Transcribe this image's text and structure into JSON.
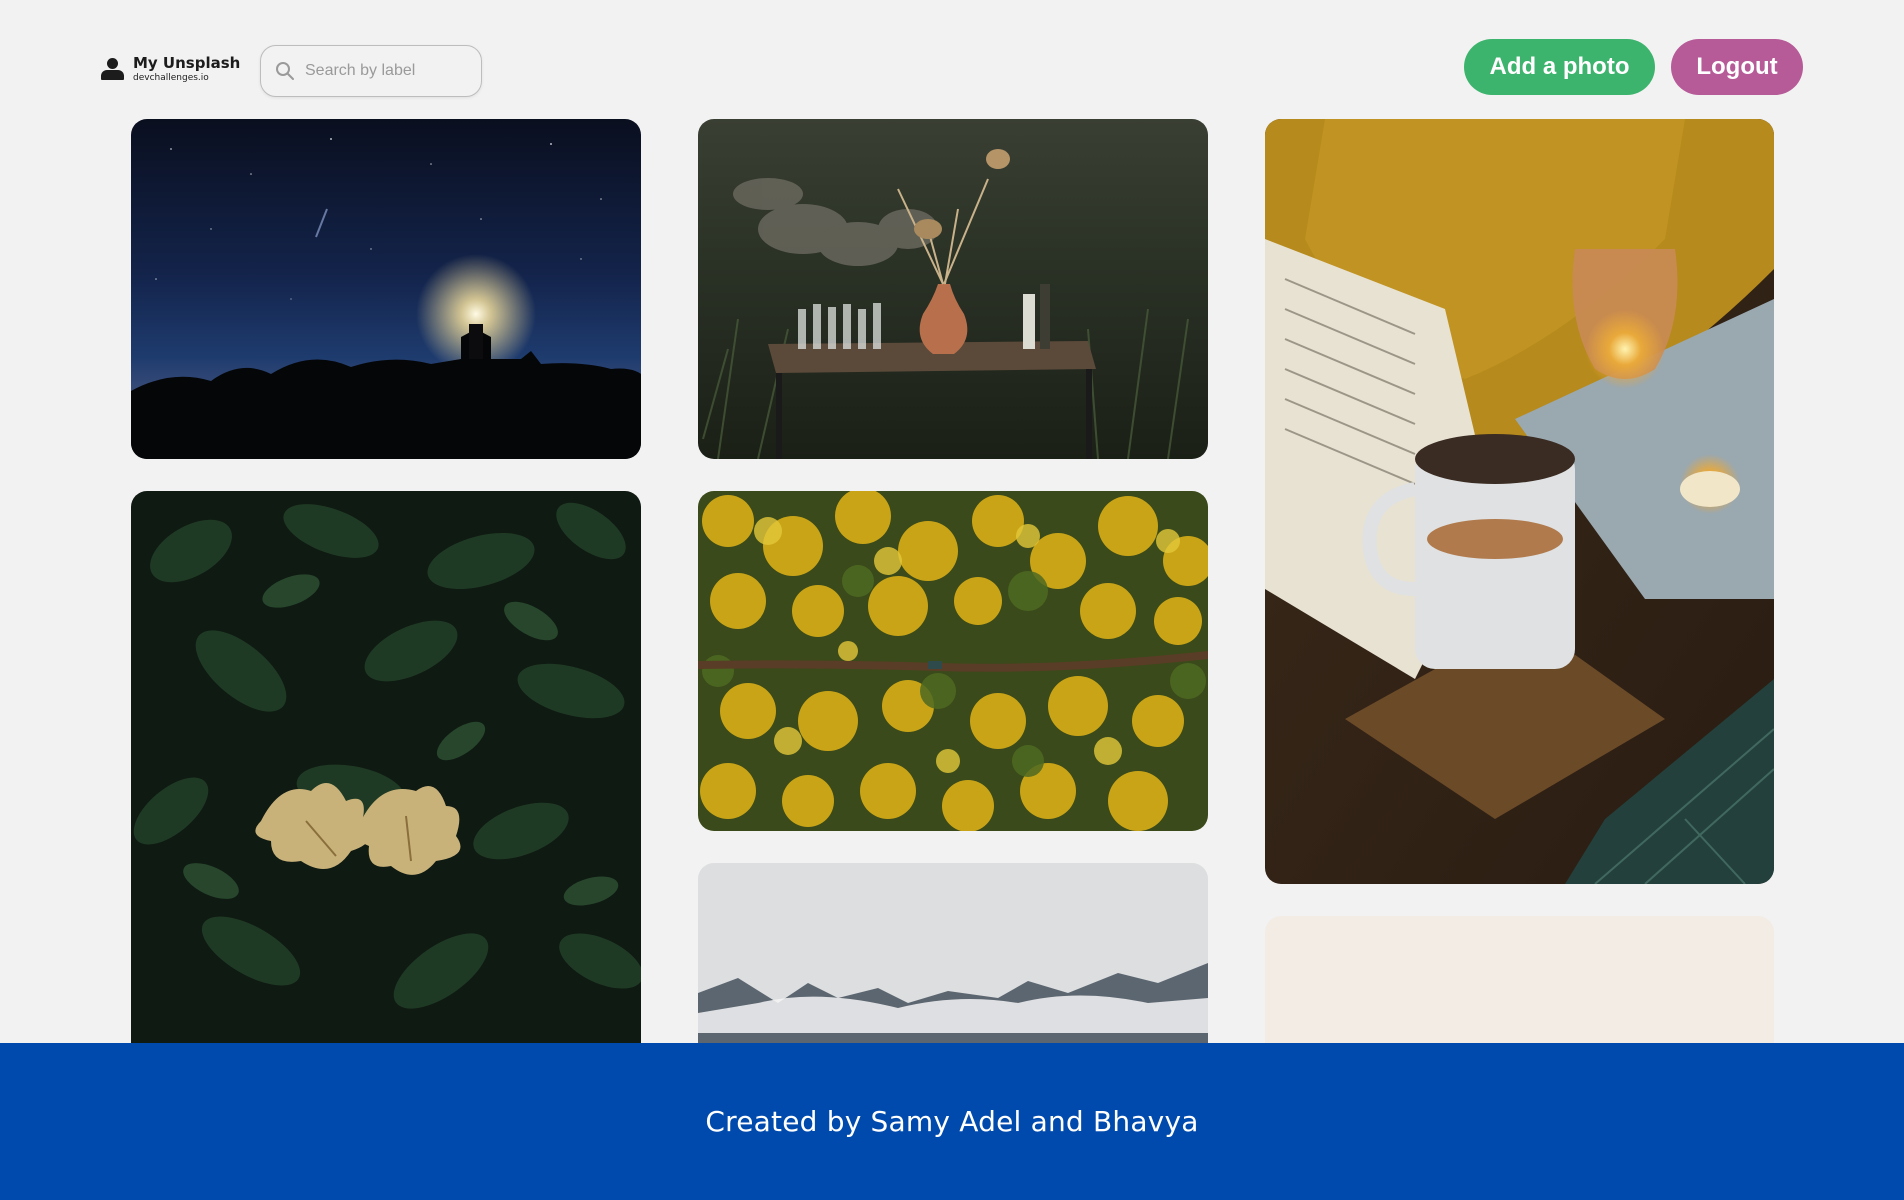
{
  "app": {
    "title": "My Unsplash",
    "subtitle": "devchallenges.io"
  },
  "search": {
    "placeholder": "Search by label",
    "value": ""
  },
  "actions": {
    "add_label": "Add a photo",
    "logout_label": "Logout"
  },
  "gallery": {
    "photos": [
      {
        "subject": "lighthouse at night under starry sky"
      },
      {
        "subject": "table with glasses and dried flowers in a vase"
      },
      {
        "subject": "book, mug and candles on a cozy table"
      },
      {
        "subject": "dark green leaves with dry oak leaves"
      },
      {
        "subject": "aerial view of autumn forest with road"
      },
      {
        "subject": "misty mountains"
      },
      {
        "subject": "pale beige photo"
      }
    ]
  },
  "footer": {
    "credit": "Created by Samy Adel and Bhavya"
  },
  "colors": {
    "background": "#f2f2f2",
    "add_button": "#3db46d",
    "logout_button": "#b65b98",
    "footer": "#004aad"
  },
  "icons": {
    "logo": "user-icon",
    "search": "search-icon"
  }
}
